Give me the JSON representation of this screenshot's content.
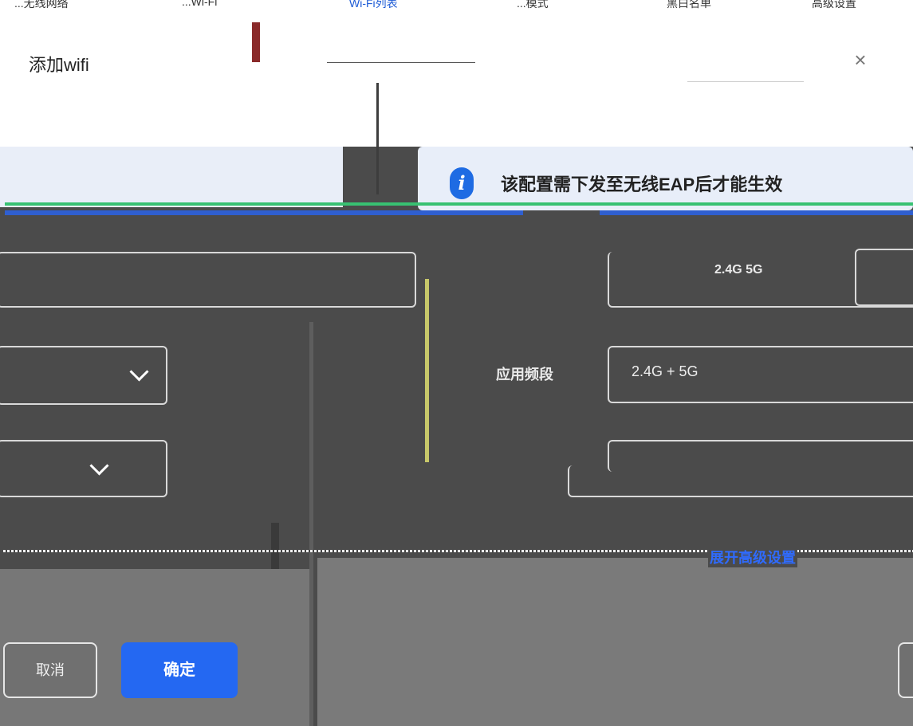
{
  "background_nav": {
    "items": [
      "...无线网络",
      "...Wi-Fi",
      "Wi-Fi列表",
      "...模式",
      "黑白名单",
      "高级设置"
    ]
  },
  "modal": {
    "title": "添加wifi",
    "close_glyph": "×",
    "info_banner": {
      "icon": "info-icon",
      "text": "该配置需下发至无线EAP后才能生效"
    },
    "fields": {
      "band_label": "应用频段",
      "band_value": "2.4G + 5G",
      "right_top_value": "2.4G 5G"
    },
    "expand_link": "展开高级设置",
    "buttons": {
      "cancel": "取消",
      "ok": "确定"
    },
    "colors": {
      "primary": "#2468f2",
      "info_bg": "#e8eef9",
      "green_strip": "#38c172",
      "blue_strip": "#2f5fd0"
    }
  }
}
